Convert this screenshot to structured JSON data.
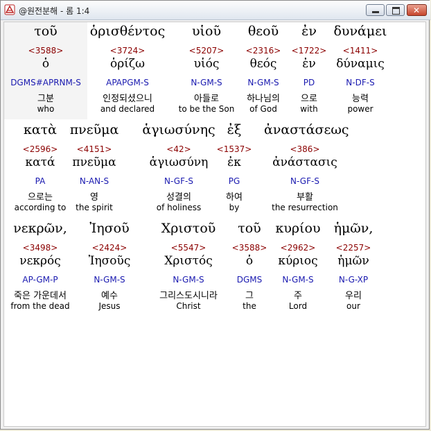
{
  "window": {
    "title": "@원전분해 - 롬 1:4",
    "min_icon": "minimize-icon",
    "max_icon": "maximize-icon",
    "close_icon": "close-icon"
  },
  "rows": [
    {
      "words": [
        {
          "greek": "τοῦ",
          "strong": "<3588>",
          "lemma": "ὁ",
          "parse": "DGMS#APRNM-S",
          "korean": "그분",
          "english": "who"
        },
        {
          "greek": "ὁρισθέντος",
          "strong": "<3724>",
          "lemma": "ὁρίζω",
          "parse": "APAPGM-S",
          "korean": "인정되셨으니",
          "english": "and declared"
        },
        {
          "greek": "υἱοῦ",
          "strong": "<5207>",
          "lemma": "υἱός",
          "parse": "N-GM-S",
          "korean": "아들로",
          "english": "to be the Son"
        },
        {
          "greek": "θεοῦ",
          "strong": "<2316>",
          "lemma": "θεός",
          "parse": "N-GM-S",
          "korean": "하나님의",
          "english": "of God"
        },
        {
          "greek": "ἐν",
          "strong": "<1722>",
          "lemma": "ἐν",
          "parse": "PD",
          "korean": "으로",
          "english": "with"
        },
        {
          "greek": "δυνάμει",
          "strong": "<1411>",
          "lemma": "δύναμις",
          "parse": "N-DF-S",
          "korean": "능력",
          "english": "power"
        }
      ]
    },
    {
      "words": [
        {
          "greek": "κατὰ",
          "strong": "<2596>",
          "lemma": "κατά",
          "parse": "PA",
          "korean": "으로는",
          "english": "according to"
        },
        {
          "greek": "πνεῦμα",
          "strong": "<4151>",
          "lemma": "πνεῦμα",
          "parse": "N-AN-S",
          "korean": "영",
          "english": "the spirit"
        },
        {
          "greek": "ἁγιωσύνης",
          "strong": "<42>",
          "lemma": "ἁγιωσύνη",
          "parse": "N-GF-S",
          "korean": "성결의",
          "english": "of holiness"
        },
        {
          "greek": "ἐξ",
          "strong": "<1537>",
          "lemma": "ἐκ",
          "parse": "PG",
          "korean": "하여",
          "english": "by"
        },
        {
          "greek": "ἀναστάσεως",
          "strong": "<386>",
          "lemma": "ἀνάστασις",
          "parse": "N-GF-S",
          "korean": "부활",
          "english": "the resurrection"
        }
      ]
    },
    {
      "words": [
        {
          "greek": "νεκρῶν,",
          "strong": "<3498>",
          "lemma": "νεκρός",
          "parse": "AP-GM-P",
          "korean": "죽은 가운데서",
          "english": "from the dead"
        },
        {
          "greek": "Ἰησοῦ",
          "strong": "<2424>",
          "lemma": "Ἰησοῦς",
          "parse": "N-GM-S",
          "korean": "예수",
          "english": "Jesus"
        },
        {
          "greek": "Χριστοῦ",
          "strong": "<5547>",
          "lemma": "Χριστός",
          "parse": "N-GM-S",
          "korean": "그리스도시니라",
          "english": "Christ"
        },
        {
          "greek": "τοῦ",
          "strong": "<3588>",
          "lemma": "ὁ",
          "parse": "DGMS",
          "korean": "그",
          "english": "the"
        },
        {
          "greek": "κυρίου",
          "strong": "<2962>",
          "lemma": "κύριος",
          "parse": "N-GM-S",
          "korean": "주",
          "english": "Lord"
        },
        {
          "greek": "ἡμῶν,",
          "strong": "<2257>",
          "lemma": "ἡμῶν",
          "parse": "N-G-XP",
          "korean": "우리",
          "english": "our"
        }
      ]
    }
  ]
}
